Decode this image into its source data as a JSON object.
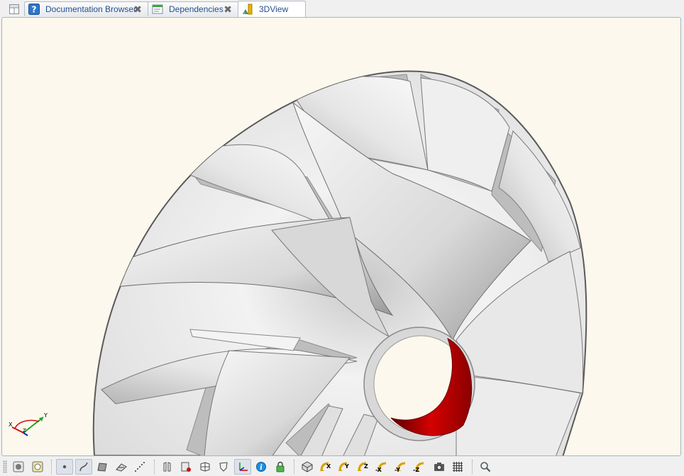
{
  "tabs": [
    {
      "label": "Documentation Browser",
      "close": "✖",
      "icon": "help-icon",
      "active": false
    },
    {
      "label": "Dependencies",
      "close": "✖",
      "icon": "dependencies-icon",
      "active": false
    },
    {
      "label": "3DView",
      "close": "",
      "icon": "3dview-icon",
      "active": true
    }
  ],
  "tab_manager_icon": "tab-manager-grid-icon",
  "viewport": {
    "background": "#fdf8ed",
    "model": "centrifugal impeller",
    "model_color": "#e4e4e4",
    "bore_color": "#c00000",
    "axis_triad": {
      "x": "X",
      "y": "Y",
      "z": "Z"
    }
  },
  "toolbar": {
    "groups": [
      [
        "select-vertex-icon",
        "select-face-icon"
      ],
      [
        "point-icon",
        "curve-icon",
        "surface-icon",
        "plane-icon",
        "point-cloud-icon"
      ],
      [
        "section-icon",
        "clip-icon",
        "explode-icon",
        "shield-icon",
        "axis-icon",
        "info-icon",
        "lock-icon"
      ],
      [
        "view-iso-icon",
        "view-x-icon",
        "view-y-icon",
        "view-z-icon",
        "view-minus-x-icon",
        "view-minus-y-icon",
        "view-minus-z-icon",
        "snapshot-icon",
        "grid-icon"
      ],
      [
        "zoom-icon"
      ]
    ],
    "view_labels": {
      "x": "X",
      "y": "Y",
      "z": "Z",
      "mx": "-X",
      "my": "-Y",
      "mz": "-Z"
    }
  }
}
